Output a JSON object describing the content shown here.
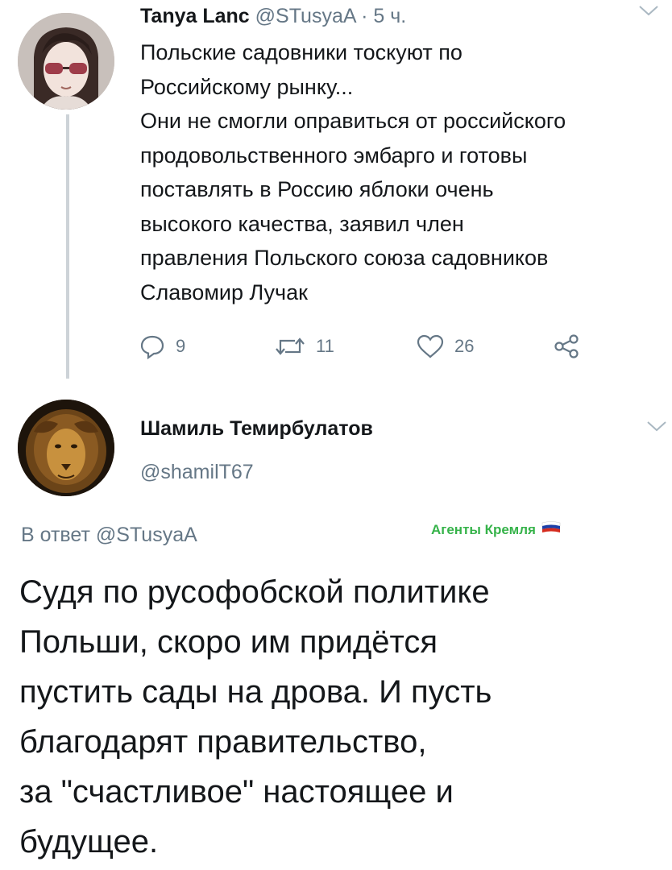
{
  "tweet1": {
    "display_name": "Tanya Lanc",
    "handle": "@STusyaA",
    "separator": "·",
    "time": "5 ч.",
    "text_lines": [
      "Польские садовники тоскуют по",
      "Российскому рынку...",
      "Они не смогли оправиться от российского",
      "продовольственного эмбарго и готовы",
      "поставлять в Россию яблоки очень",
      "высокого качества, заявил член",
      "правления Польского союза садовников",
      "Славомир Лучак"
    ],
    "actions": {
      "replies": "9",
      "retweets": "11",
      "likes": "26"
    }
  },
  "tweet2": {
    "display_name": "Шамиль Темирбулатов",
    "handle": "@shamilT67",
    "reply_prefix": "В ответ",
    "reply_mention": "@STusyaA",
    "badge": "Агенты Кремля",
    "text_lines": [
      "Судя по русофобской политике",
      "Польши, скоро им придётся",
      "пустить сады на дрова. И пусть",
      "благодарят правительство,",
      "за \"счастливое\" настоящее и",
      "будущее."
    ]
  },
  "icons": {
    "reply": "reply-icon",
    "retweet": "retweet-icon",
    "like": "heart-icon",
    "share": "share-icon",
    "caret": "chevron-down-icon",
    "flag": "russia-flag-icon"
  },
  "colors": {
    "text": "#14171a",
    "meta": "#657786",
    "badge": "#36b34a",
    "thread_line": "#cdd3d8"
  }
}
